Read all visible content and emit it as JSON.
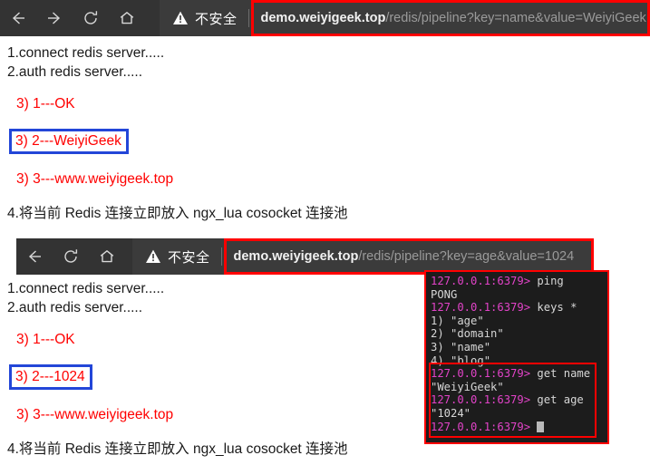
{
  "browser_bar_1": {
    "nav": [
      {
        "name": "back-button",
        "glyph": "arrow-left"
      },
      {
        "name": "forward-button",
        "glyph": "arrow-right"
      },
      {
        "name": "reload-button",
        "glyph": "reload"
      },
      {
        "name": "home-button",
        "glyph": "home"
      }
    ],
    "security_label": "不安全",
    "security_icon": "warning-triangle-icon",
    "url_host": "demo.weiyigeek.top",
    "url_path": "/redis/pipeline?key=name&value=WeiyiGeek",
    "highlight_color": "#ff0000"
  },
  "browser_bar_2": {
    "nav": [
      {
        "name": "back-button",
        "glyph": "arrow-left"
      },
      {
        "name": "reload-button",
        "glyph": "reload"
      },
      {
        "name": "home-button",
        "glyph": "home"
      }
    ],
    "security_label": "不安全",
    "security_icon": "warning-triangle-icon",
    "url_host": "demo.weiyigeek.top",
    "url_path": "/redis/pipeline?key=age&value=1024",
    "highlight_color": "#ff0000"
  },
  "page_1": {
    "line1": "1.connect redis server.....",
    "line2": "2.auth redis server.....",
    "result1": "3) 1---OK",
    "result2_boxed": "3) 2---WeiyiGeek",
    "result3": "3) 3---www.weiyigeek.top",
    "line4": "4.将当前 Redis 连接立即放入 ngx_lua cosocket 连接池",
    "box_color": "#2346d8",
    "text_color": "#ff0000"
  },
  "page_2": {
    "line1": "1.connect redis server.....",
    "line2": "2.auth redis server.....",
    "result1": "3) 1---OK",
    "result2_boxed": "3) 2---1024",
    "result3": "3) 3---www.weiyigeek.top",
    "line4": "4.将当前 Redis 连接立即放入 ngx_lua cosocket 连接池",
    "box_color": "#2346d8",
    "text_color": "#ff0000"
  },
  "terminal": {
    "prompt": "127.0.0.1:6379>",
    "prompt_color": "#e243c8",
    "background": "#1c1c1c",
    "highlight_color": "#ff0000",
    "lines": [
      {
        "type": "cmd",
        "cmd": " ping"
      },
      {
        "type": "out",
        "text": "PONG"
      },
      {
        "type": "cmd",
        "cmd": " keys *"
      },
      {
        "type": "out",
        "text": "1) \"age\""
      },
      {
        "type": "out",
        "text": "2) \"domain\""
      },
      {
        "type": "out",
        "text": "3) \"name\""
      },
      {
        "type": "out",
        "text": "4) \"blog\""
      },
      {
        "type": "cmd",
        "cmd": " get name"
      },
      {
        "type": "out",
        "text": "\"WeiyiGeek\""
      },
      {
        "type": "cmd",
        "cmd": " get age"
      },
      {
        "type": "out",
        "text": "\"1024\""
      },
      {
        "type": "cursor",
        "cmd": " "
      }
    ]
  }
}
